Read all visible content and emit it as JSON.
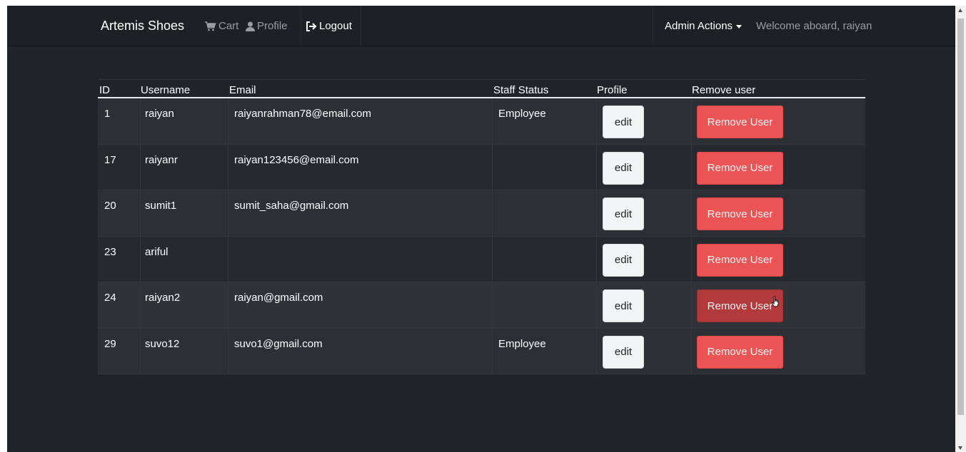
{
  "navbar": {
    "brand": "Artemis Shoes",
    "links": [
      {
        "label": "Cart",
        "icon": "cart-icon"
      },
      {
        "label": "Profile",
        "icon": "user-icon"
      },
      {
        "label": "Logout",
        "icon": "logout-icon"
      }
    ],
    "admin_actions": "Admin Actions",
    "welcome": "Welcome aboard, raiyan"
  },
  "table": {
    "headers": [
      "ID",
      "Username",
      "Email",
      "Staff Status",
      "Profile",
      "Remove user"
    ],
    "rows": [
      {
        "id": "1",
        "username": "raiyan",
        "email": "raiyanrahman78@email.com",
        "staff_status": "Employee"
      },
      {
        "id": "17",
        "username": "raiyanr",
        "email": "raiyan123456@email.com",
        "staff_status": ""
      },
      {
        "id": "20",
        "username": "sumit1",
        "email": "sumit_saha@gmail.com",
        "staff_status": ""
      },
      {
        "id": "23",
        "username": "ariful",
        "email": "",
        "staff_status": ""
      },
      {
        "id": "24",
        "username": "raiyan2",
        "email": "raiyan@gmail.com",
        "staff_status": ""
      },
      {
        "id": "29",
        "username": "suvo12",
        "email": "suvo1@gmail.com",
        "staff_status": "Employee"
      }
    ],
    "edit_label": "edit",
    "remove_label": "Remove User"
  },
  "colors": {
    "page_bg": "#212529",
    "remove_button": "#ea5455",
    "remove_button_active": "#b33a3c"
  }
}
